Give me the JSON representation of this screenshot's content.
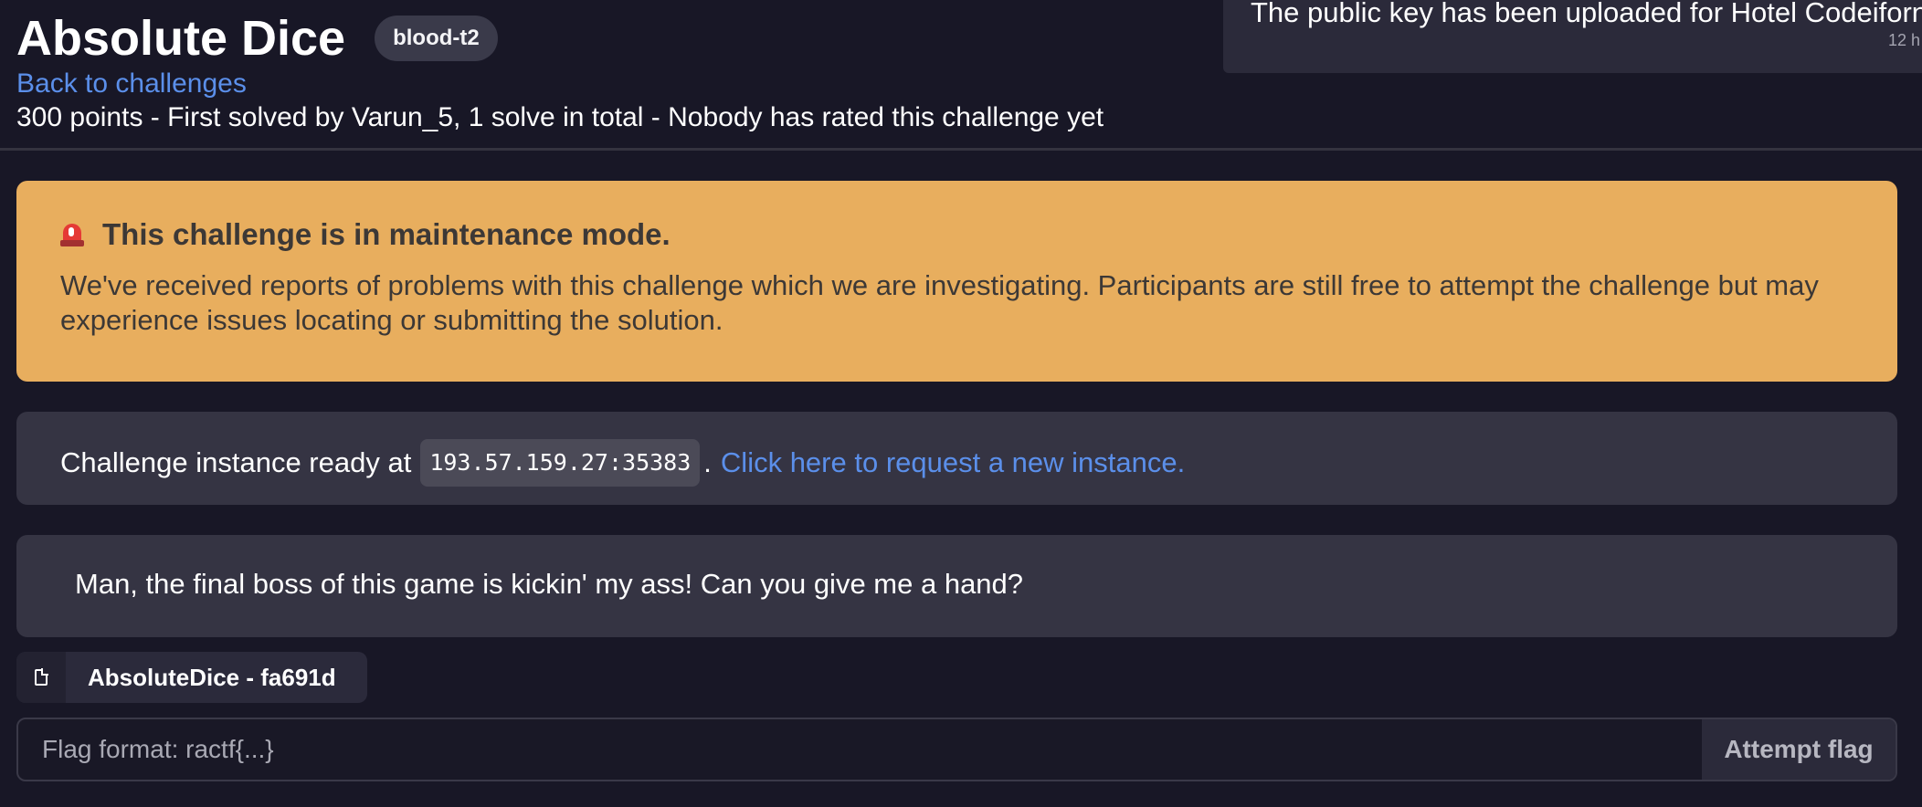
{
  "header": {
    "title": "Absolute Dice",
    "tag": "blood-t2",
    "back_link": "Back to challenges",
    "meta": "300 points - First solved by Varun_5, 1 solve in total - Nobody has rated this challenge yet"
  },
  "notification": {
    "text": "The public key has been uploaded for Hotel Codeiforn",
    "time": "12 h"
  },
  "maintenance": {
    "icon": "siren-icon",
    "title": "This challenge is in maintenance mode.",
    "body": "We've received reports of problems with this challenge which we are investigating. Participants are still free to attempt the challenge but may experience issues locating or submitting the solution."
  },
  "instance": {
    "prefix": "Challenge instance ready at",
    "address": "193.57.159.27:35383",
    "separator": ".",
    "link_text": "Click here to request a new instance."
  },
  "description": "Man, the final boss of this game is kickin' my ass! Can you give me a hand?",
  "file": {
    "icon": "file-icon",
    "label": "AbsoluteDice - fa691d"
  },
  "flag_form": {
    "placeholder": "Flag format: ractf{...}",
    "value": "",
    "button": "Attempt flag"
  },
  "colors": {
    "background": "#181726",
    "card": "#353443",
    "banner": "#e8ae5e",
    "link": "#5b8fea"
  }
}
